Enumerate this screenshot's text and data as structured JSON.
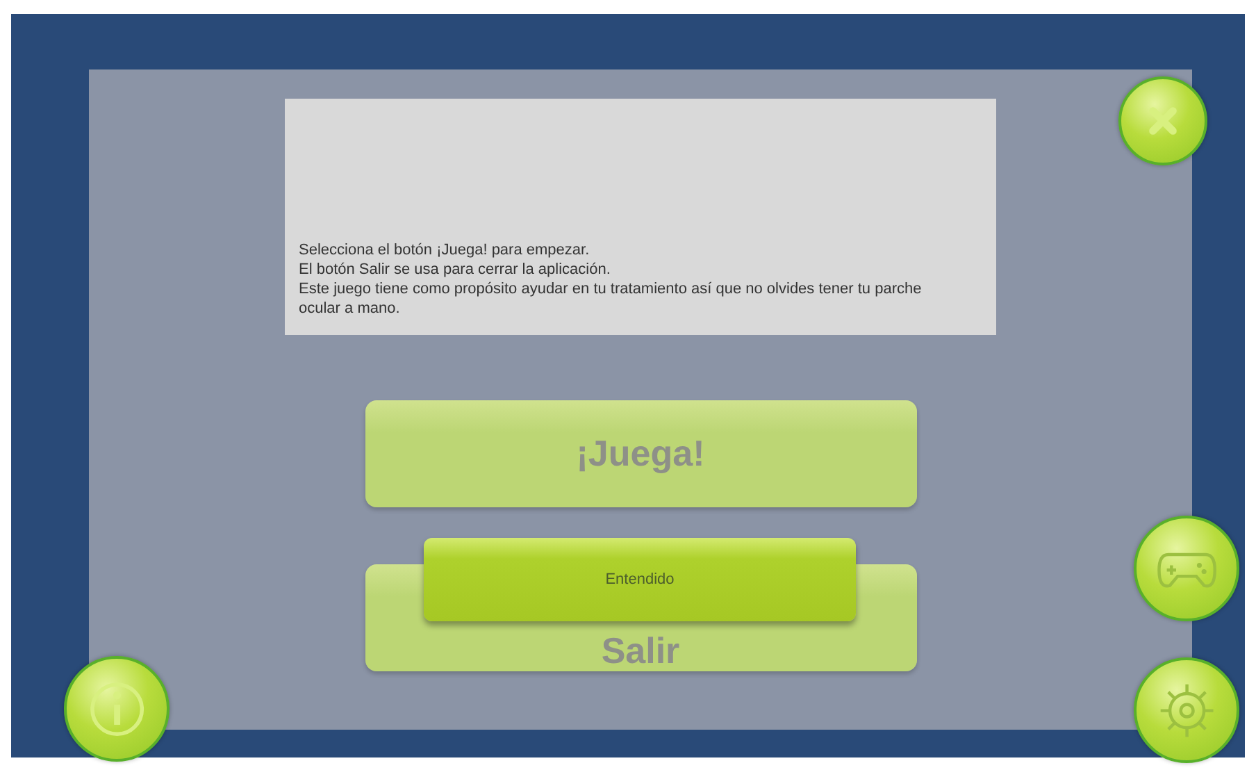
{
  "message": {
    "lines": [
      "Selecciona el botón ¡Juega! para empezar.",
      "El botón Salir se usa para cerrar la aplicación.",
      "Este juego tiene como propósito ayudar en tu tratamiento así que no olvides tener tu parche ocular a mano."
    ]
  },
  "menu_buttons": [
    {
      "label": "¡Juega!"
    },
    {
      "label": "Salir"
    }
  ],
  "dialog_button": {
    "label": "Entendido"
  },
  "round_buttons": [
    {
      "kind": "close"
    },
    {
      "kind": "gamepad"
    },
    {
      "kind": "settings"
    },
    {
      "kind": "info"
    }
  ]
}
